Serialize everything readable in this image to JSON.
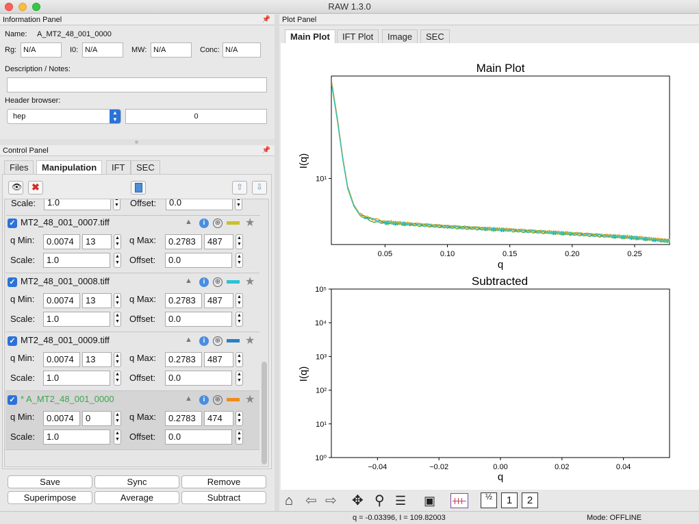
{
  "window": {
    "title": "RAW 1.3.0"
  },
  "info_panel": {
    "header": "Information Panel",
    "name_label": "Name:",
    "name_value": "A_MT2_48_001_0000",
    "rg_label": "Rg:",
    "rg_value": "N/A",
    "i0_label": "I0:",
    "i0_value": "N/A",
    "mw_label": "MW:",
    "mw_value": "N/A",
    "conc_label": "Conc:",
    "conc_value": "N/A",
    "desc_label": "Description / Notes:",
    "desc_value": "",
    "header_browser_label": "Header browser:",
    "header_select": "hep",
    "header_value": "0"
  },
  "control_panel": {
    "header": "Control Panel",
    "tabs": [
      "Files",
      "Manipulation",
      "IFT",
      "SEC"
    ],
    "active_tab": "Manipulation"
  },
  "manip": {
    "partial": {
      "scale_label": "Scale:",
      "scale": "1.0",
      "offset_label": "Offset:",
      "offset": "0.0"
    },
    "items": [
      {
        "name": "MT2_48_001_0007.tiff",
        "qmin_label": "q Min:",
        "qmin": "0.0074",
        "qmin_idx": "13",
        "qmax_label": "q Max:",
        "qmax": "0.2783",
        "qmax_idx": "487",
        "scale_label": "Scale:",
        "scale": "1.0",
        "offset_label": "Offset:",
        "offset": "0.0",
        "color": "#c8c02a"
      },
      {
        "name": "MT2_48_001_0008.tiff",
        "qmin_label": "q Min:",
        "qmin": "0.0074",
        "qmin_idx": "13",
        "qmax_label": "q Max:",
        "qmax": "0.2783",
        "qmax_idx": "487",
        "scale_label": "Scale:",
        "scale": "1.0",
        "offset_label": "Offset:",
        "offset": "0.0",
        "color": "#2cc3d6"
      },
      {
        "name": "MT2_48_001_0009.tiff",
        "qmin_label": "q Min:",
        "qmin": "0.0074",
        "qmin_idx": "13",
        "qmax_label": "q Max:",
        "qmax": "0.2783",
        "qmax_idx": "487",
        "scale_label": "Scale:",
        "scale": "1.0",
        "offset_label": "Offset:",
        "offset": "0.0",
        "color": "#2b7fc0"
      },
      {
        "name": "* A_MT2_48_001_0000",
        "qmin_label": "q Min:",
        "qmin": "0.0074",
        "qmin_idx": "0",
        "qmax_label": "q Max:",
        "qmax": "0.2783",
        "qmax_idx": "474",
        "scale_label": "Scale:",
        "scale": "1.0",
        "offset_label": "Offset:",
        "offset": "0.0",
        "color": "#f08a1c",
        "name_color": "#3aa84a"
      }
    ],
    "buttons": [
      "Save",
      "Sync",
      "Remove",
      "Superimpose",
      "Average",
      "Subtract"
    ]
  },
  "plot_panel": {
    "header": "Plot Panel",
    "tabs": [
      "Main Plot",
      "IFT Plot",
      "Image",
      "SEC"
    ],
    "active_tab": "Main Plot"
  },
  "chart_data": [
    {
      "type": "line",
      "title": "Main Plot",
      "xlabel": "q",
      "ylabel": "I(q)",
      "yscale": "log",
      "xlim": [
        0.007,
        0.278
      ],
      "x_ticks": [
        "0.05",
        "0.10",
        "0.15",
        "0.20",
        "0.25"
      ],
      "y_ticks": [
        "10¹"
      ],
      "series": [
        {
          "color": "#1f77b4",
          "x": [
            0.0074,
            0.012,
            0.016,
            0.02,
            0.025,
            0.03,
            0.04,
            0.05,
            0.07,
            0.1,
            0.13,
            0.15,
            0.18,
            0.2,
            0.23,
            0.25,
            0.27,
            0.2783
          ],
          "y": [
            60,
            30,
            15,
            8.5,
            6.0,
            5.0,
            4.55,
            4.35,
            4.2,
            4.0,
            3.85,
            3.75,
            3.6,
            3.5,
            3.35,
            3.25,
            3.1,
            3.05
          ]
        },
        {
          "color": "#ff7f0e",
          "x": [
            0.0074,
            0.012,
            0.016,
            0.02,
            0.025,
            0.03,
            0.04,
            0.05,
            0.07,
            0.1,
            0.13,
            0.15,
            0.18,
            0.2,
            0.23,
            0.25,
            0.27,
            0.2783
          ],
          "y": [
            62,
            31,
            15.5,
            8.7,
            6.1,
            5.05,
            4.6,
            4.4,
            4.22,
            4.02,
            3.87,
            3.77,
            3.62,
            3.52,
            3.37,
            3.27,
            3.12,
            3.07
          ]
        },
        {
          "color": "#2ca02c",
          "x": [
            0.0074,
            0.012,
            0.016,
            0.02,
            0.025,
            0.03,
            0.04,
            0.05,
            0.07,
            0.1,
            0.13,
            0.15,
            0.18,
            0.2,
            0.23,
            0.25,
            0.27,
            0.2783
          ],
          "y": [
            58,
            29,
            14.6,
            8.3,
            5.9,
            4.95,
            4.5,
            4.3,
            4.18,
            3.98,
            3.83,
            3.73,
            3.58,
            3.48,
            3.33,
            3.23,
            3.08,
            3.03
          ]
        },
        {
          "color": "#c8c02a",
          "x": [
            0.0074,
            0.012,
            0.016,
            0.02,
            0.025,
            0.03,
            0.04,
            0.05,
            0.07,
            0.1,
            0.13,
            0.15,
            0.18,
            0.2,
            0.23,
            0.25,
            0.27,
            0.2783
          ],
          "y": [
            61,
            30.5,
            15.2,
            8.6,
            6.05,
            5.02,
            4.57,
            4.37,
            4.21,
            4.01,
            3.86,
            3.76,
            3.61,
            3.51,
            3.36,
            3.26,
            3.11,
            3.06
          ]
        },
        {
          "color": "#2cc3d6",
          "x": [
            0.0074,
            0.012,
            0.016,
            0.02,
            0.025,
            0.03,
            0.04,
            0.05,
            0.07,
            0.1,
            0.13,
            0.15,
            0.18,
            0.2,
            0.23,
            0.25,
            0.27,
            0.2783
          ],
          "y": [
            59,
            29.5,
            14.8,
            8.4,
            5.95,
            4.98,
            4.52,
            4.32,
            4.19,
            3.99,
            3.84,
            3.74,
            3.59,
            3.49,
            3.34,
            3.24,
            3.09,
            3.04
          ]
        }
      ]
    },
    {
      "type": "line",
      "title": "Subtracted",
      "xlabel": "q",
      "ylabel": "I(q)",
      "yscale": "log",
      "xlim": [
        -0.055,
        0.055
      ],
      "ylim": [
        1,
        100000
      ],
      "x_ticks": [
        "−0.04",
        "−0.02",
        "0.00",
        "0.02",
        "0.04"
      ],
      "y_ticks": [
        "10⁰",
        "10¹",
        "10²",
        "10³",
        "10⁴",
        "10⁵"
      ],
      "series": []
    }
  ],
  "toolbar": {
    "icons": [
      "home-icon",
      "back-icon",
      "forward-icon",
      "pan-icon",
      "zoom-icon",
      "configure-icon",
      "save-icon",
      "legend-icon"
    ],
    "page_split": "½",
    "page_1": "1",
    "page_2": "2"
  },
  "statusbar": {
    "coords": "q = -0.03396, I = 109.82003",
    "mode": "Mode: OFFLINE"
  }
}
